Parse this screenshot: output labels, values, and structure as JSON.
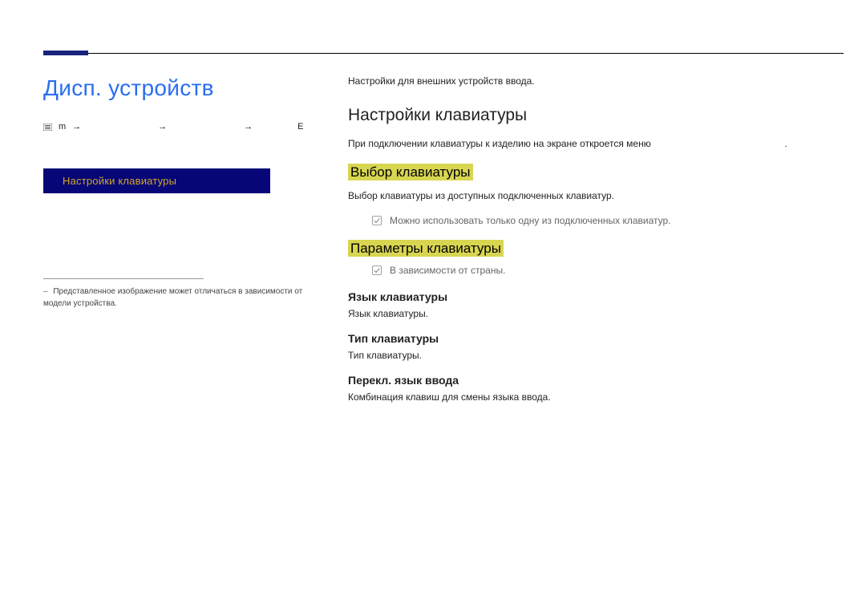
{
  "page": {
    "title": "Дисп. устройств"
  },
  "breadcrumb": {
    "part1": "m",
    "arrow": "→",
    "end": "E"
  },
  "sidebar": {
    "items": [
      {
        "label": "Настройки клавиатуры"
      }
    ]
  },
  "footnote": {
    "text": "Представленное изображение может отличаться в зависимости от модели устройства."
  },
  "content": {
    "intro": "Настройки для внешних устройств ввода.",
    "h2": "Настройки клавиатуры",
    "desc": "При подключении клавиатуры к изделию на экране откроется меню",
    "desc_trail": ".",
    "sub1": {
      "title": "Выбор клавиатуры",
      "body": "Выбор клавиатуры из доступных подключенных клавиатур.",
      "note": "Можно использовать только одну из подключенных клавиатур."
    },
    "sub2": {
      "title": "Параметры клавиатуры",
      "note": "В зависимости от страны.",
      "items": [
        {
          "head": "Язык клавиатуры",
          "body": "Язык клавиатуры."
        },
        {
          "head": "Тип клавиатуры",
          "body": "Тип клавиатуры."
        },
        {
          "head": "Перекл. язык ввода",
          "body": "Комбинация клавиш для смены языка ввода."
        }
      ]
    }
  }
}
